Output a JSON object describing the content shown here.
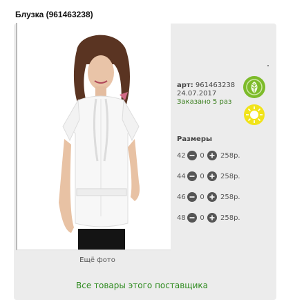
{
  "product": {
    "title": "Блузка (961463238)",
    "more_photo": "Ещё фото",
    "art_label": "арт:",
    "art_value": "961463238",
    "date": "24.07.2017",
    "ordered": "Заказано 5 раз",
    "eco_icon": "leaf-icon",
    "sun_icon": "sun-icon",
    "eco_color": "#7dbb2a",
    "sun_color": "#f1e31a"
  },
  "sizes": {
    "title": "Размеры",
    "rows": [
      {
        "size": "42",
        "qty": "0",
        "price": "258р."
      },
      {
        "size": "44",
        "qty": "0",
        "price": "258р."
      },
      {
        "size": "46",
        "qty": "0",
        "price": "258р."
      },
      {
        "size": "48",
        "qty": "0",
        "price": "258р."
      }
    ]
  },
  "supplier_link": "Все товары этого поставщика",
  "colors": {
    "accent_green": "#2e8b1f",
    "panel_bg": "#ececec"
  }
}
